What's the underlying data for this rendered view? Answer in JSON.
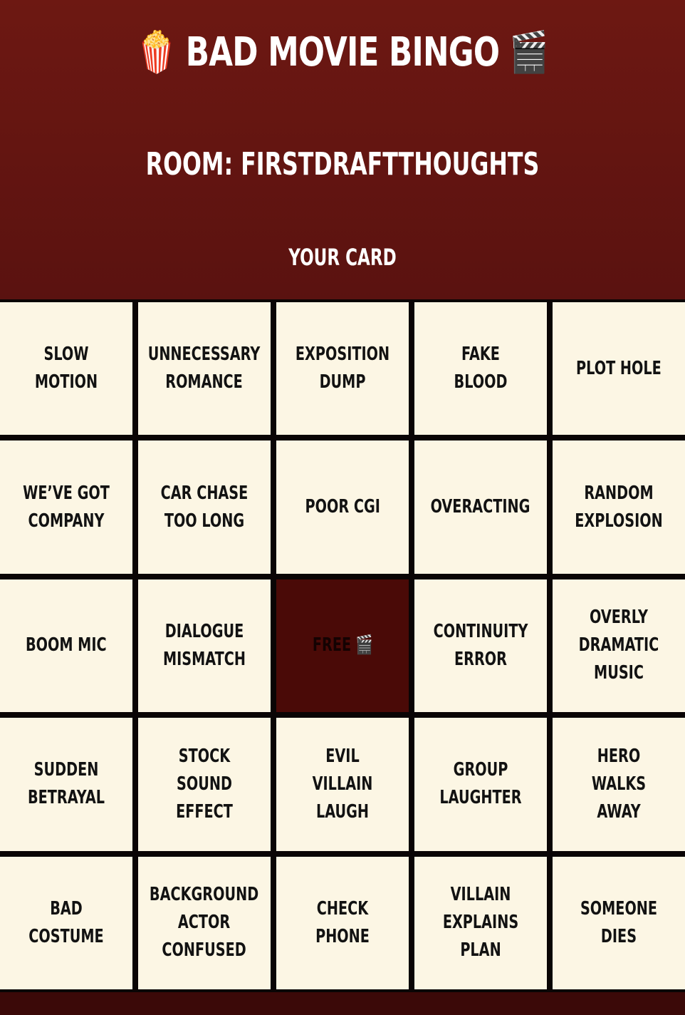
{
  "header": {
    "title": "🍿 BAD MOVIE BINGO 🎬",
    "room": "ROOM: FIRSTDRAFTTHOUGHTS",
    "subtitle": "YOUR CARD"
  },
  "card": {
    "cells": [
      "SLOW MOTION",
      "UNNECESSARY ROMANCE",
      "EXPOSITION DUMP",
      "FAKE BLOOD",
      "PLOT HOLE",
      "WE’VE GOT COMPANY",
      "CAR CHASE TOO LONG",
      "POOR CGI",
      "OVERACTING",
      "RANDOM EXPLOSION",
      "BOOM MIC",
      "DIALOGUE MISMATCH",
      "FREE 🎬",
      "CONTINUITY ERROR",
      "OVERLY DRAMATIC MUSIC",
      "SUDDEN BETRAYAL",
      "STOCK SOUND EFFECT",
      "EVIL VILLAIN LAUGH",
      "GROUP LAUGHTER",
      "HERO WALKS AWAY",
      "BAD COSTUME",
      "BACKGROUND ACTOR CONFUSED",
      "CHECK PHONE",
      "VILLAIN EXPLAINS PLAN",
      "SOMEONE DIES"
    ]
  },
  "colors": {
    "header_bg": "#6d1812",
    "cell_bg": "#fcf6e4",
    "free_bg": "#4a0a07",
    "grid_lines": "#0a0505"
  }
}
